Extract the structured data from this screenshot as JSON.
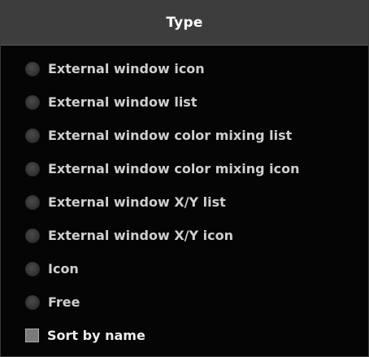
{
  "panel": {
    "title": "Type"
  },
  "options": [
    {
      "label": "External window icon",
      "selected": false
    },
    {
      "label": "External window list",
      "selected": false
    },
    {
      "label": "External window color mixing list",
      "selected": false
    },
    {
      "label": "External window color mixing icon",
      "selected": false
    },
    {
      "label": "External window X/Y list",
      "selected": false
    },
    {
      "label": "External window X/Y icon",
      "selected": false
    },
    {
      "label": "Icon",
      "selected": false
    },
    {
      "label": "Free",
      "selected": false
    }
  ],
  "sort": {
    "label": "Sort by name",
    "checked": false
  },
  "colors": {
    "background": "#050505",
    "header": "#3d3d3d",
    "text": "#cfcfcf",
    "radio": "#333333",
    "checkbox": "#7b7b7b"
  }
}
